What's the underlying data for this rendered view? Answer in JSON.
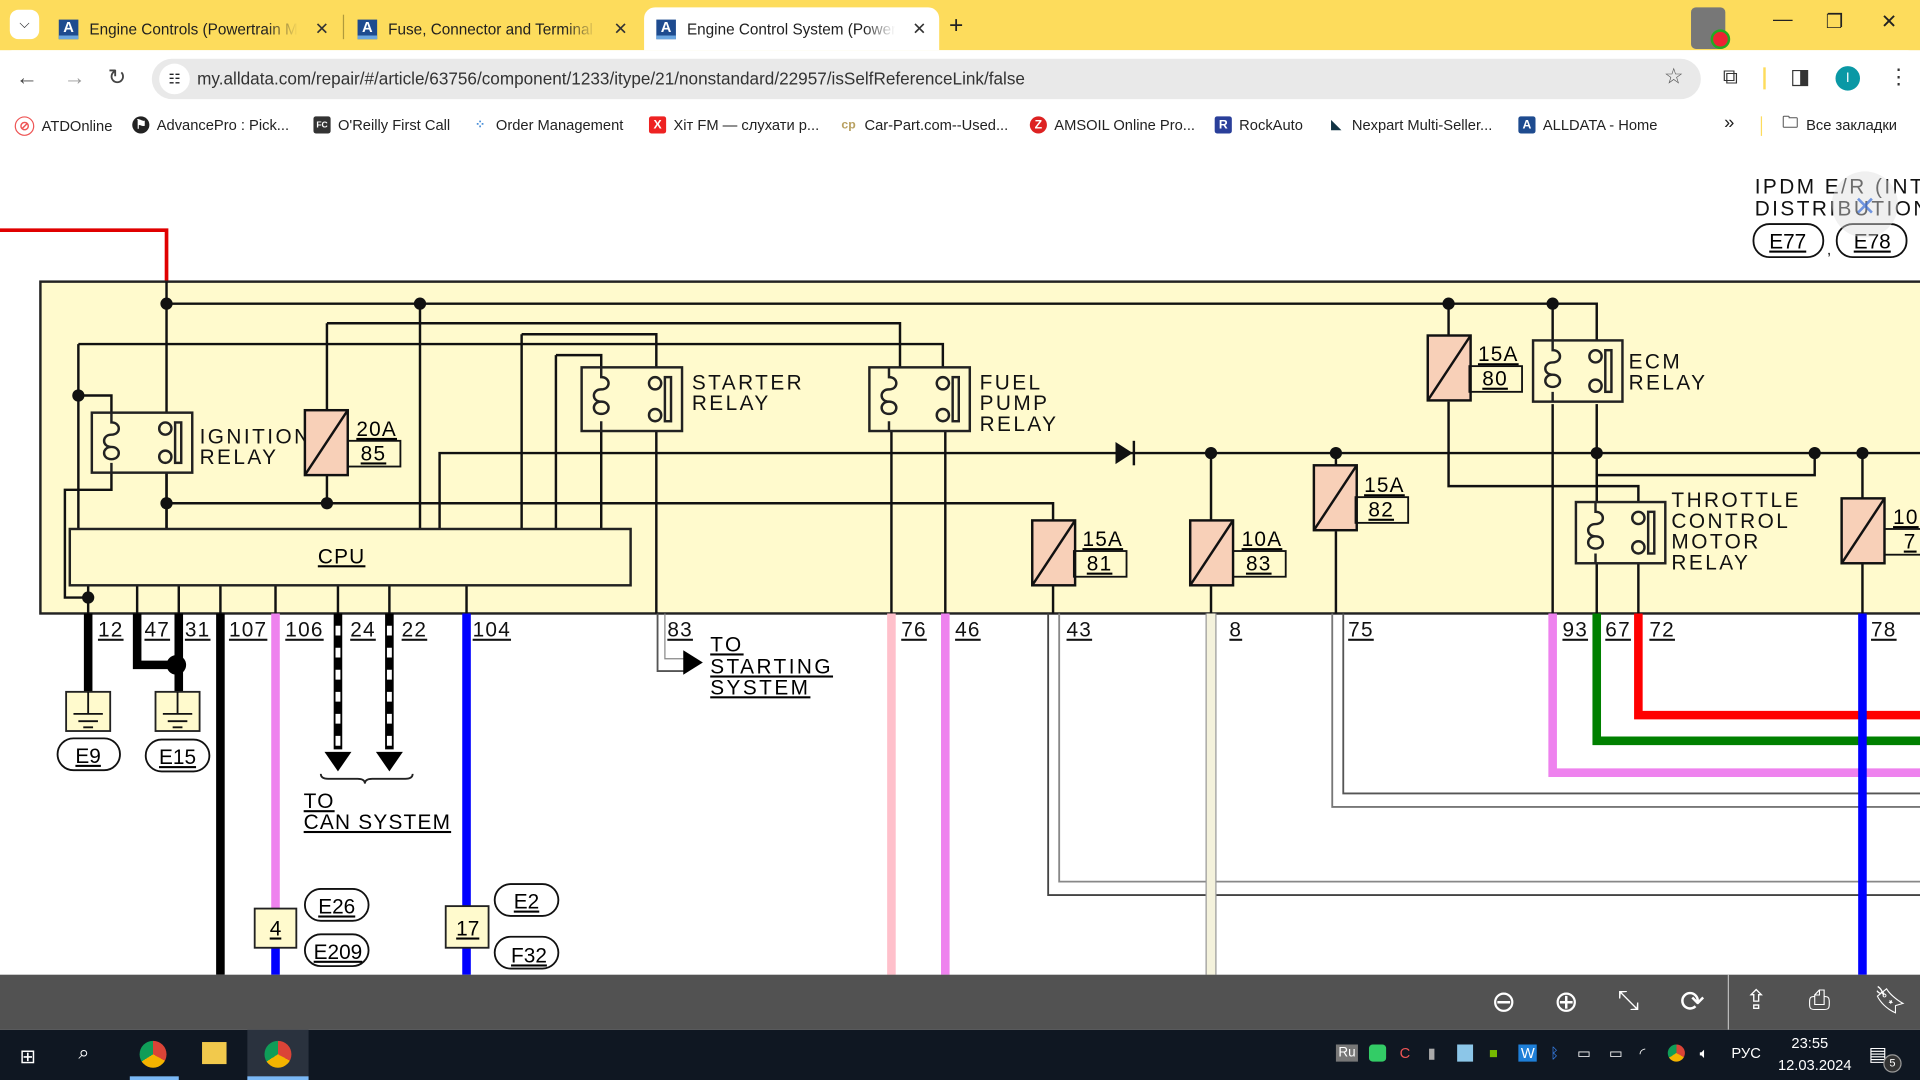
{
  "browser": {
    "tabs": [
      {
        "title": "Engine Controls (Powertrain Ma",
        "active": false
      },
      {
        "title": "Fuse, Connector and Terminal A",
        "active": false
      },
      {
        "title": "Engine Control System (Powertr",
        "active": true
      }
    ],
    "new_tab_label": "+",
    "url": "my.alldata.com/repair/#/article/63756/component/1233/itype/21/nonstandard/22957/isSelfReferenceLink/false",
    "profile_initial": "I",
    "bookmarks": [
      {
        "label": "ATDOnline"
      },
      {
        "label": "AdvancePro : Pick..."
      },
      {
        "label": "O'Reilly First Call"
      },
      {
        "label": "Order Management"
      },
      {
        "label": "Хіт FM — слухати р..."
      },
      {
        "label": "Car-Part.com--Used..."
      },
      {
        "label": "AMSOIL Online Pro..."
      },
      {
        "label": "RockAuto"
      },
      {
        "label": "Nexpart Multi-Seller..."
      },
      {
        "label": "ALLDATA - Home"
      }
    ],
    "bookmarks_overflow": "»",
    "all_bookmarks": "Все закладки"
  },
  "diagram": {
    "module_title_line1": "IPDM E/R (INT",
    "module_title_line2": "DISTRIBUTION",
    "module_connectors": [
      "E77",
      "E78"
    ],
    "cpu_label": "CPU",
    "relays": {
      "ignition": [
        "IGNITION",
        "RELAY"
      ],
      "starter": [
        "STARTER",
        "RELAY"
      ],
      "fuel_pump": [
        "FUEL",
        "PUMP",
        "RELAY"
      ],
      "ecm": [
        "ECM",
        "RELAY"
      ],
      "throttle": [
        "THROTTLE",
        "CONTROL",
        "MOTOR",
        "RELAY"
      ]
    },
    "fuses": [
      {
        "amps": "20A",
        "number": "85"
      },
      {
        "amps": "15A",
        "number": "81"
      },
      {
        "amps": "10A",
        "number": "83"
      },
      {
        "amps": "15A",
        "number": "82"
      },
      {
        "amps": "15A",
        "number": "80"
      },
      {
        "amps": "10",
        "number": "7"
      }
    ],
    "terminals": [
      "12",
      "47",
      "31",
      "107",
      "106",
      "24",
      "22",
      "104",
      "83",
      "76",
      "46",
      "43",
      "8",
      "75",
      "93",
      "67",
      "72",
      "78"
    ],
    "grounds": [
      "E9",
      "E15"
    ],
    "to_can": [
      "TO",
      "CAN SYSTEM"
    ],
    "to_starting": [
      "TO",
      "STARTING",
      "SYSTEM"
    ],
    "joint_4": {
      "num": "4",
      "connectors": [
        "E26",
        "E209"
      ]
    },
    "joint_17": {
      "num": "17",
      "connectors": [
        "E2",
        "F32"
      ]
    },
    "wire_colors": {
      "red": "#ff0000",
      "green": "#008000",
      "blue": "#0000ff",
      "violet": "#ee82ee",
      "pink": "#ffc0cb",
      "black": "#000000",
      "module_fill": "#fffacd",
      "fuse_fill": "#f8d0b8"
    }
  },
  "pdf_toolbar": [
    "zoom-out",
    "zoom-in",
    "fit-page",
    "rotate",
    "share",
    "print",
    "bookmark"
  ],
  "taskbar": {
    "language": "РУС",
    "time": "23:55",
    "date": "12.03.2024",
    "notifications": "5",
    "lang_badge": "Ru"
  }
}
